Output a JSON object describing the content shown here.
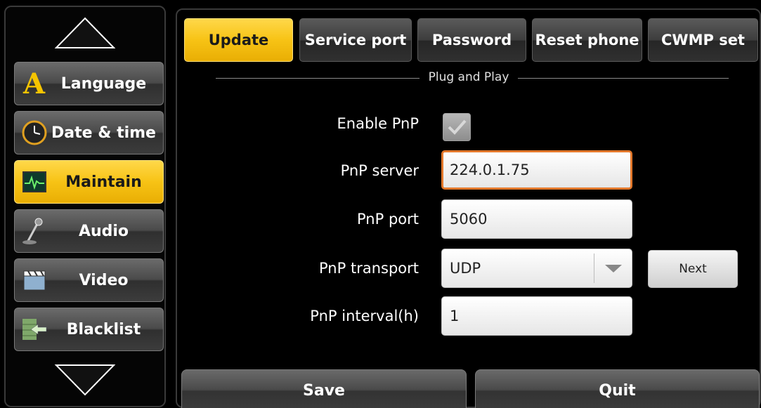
{
  "sidebar": {
    "up_icon": "triangle-up-icon",
    "down_icon": "triangle-down-icon",
    "items": [
      {
        "label": "Language",
        "icon": "letter-a-icon"
      },
      {
        "label": "Date & time",
        "icon": "clock-icon"
      },
      {
        "label": "Maintain",
        "icon": "monitor-pulse-icon",
        "active": true
      },
      {
        "label": "Audio",
        "icon": "microphone-icon"
      },
      {
        "label": "Video",
        "icon": "clapperboard-icon"
      },
      {
        "label": "Blacklist",
        "icon": "wall-arrow-icon"
      }
    ]
  },
  "tabs": [
    {
      "label": "Update",
      "active": true
    },
    {
      "label": "Service port"
    },
    {
      "label": "Password"
    },
    {
      "label": "Reset phone"
    },
    {
      "label": "CWMP set"
    }
  ],
  "section": {
    "title": "Plug and Play"
  },
  "form": {
    "enable_pnp": {
      "label": "Enable PnP",
      "checked": true
    },
    "pnp_server": {
      "label": "PnP server",
      "value": "224.0.1.75"
    },
    "pnp_port": {
      "label": "PnP port",
      "value": "5060"
    },
    "pnp_transport": {
      "label": "PnP transport",
      "value": "UDP"
    },
    "pnp_interval": {
      "label": "PnP interval(h)",
      "value": "1"
    }
  },
  "buttons": {
    "next": "Next",
    "save": "Save",
    "quit": "Quit"
  },
  "colors": {
    "accent_yellow": "#f7c315",
    "focus_orange": "#e3782b",
    "button_gray": "#4a4a4a"
  }
}
